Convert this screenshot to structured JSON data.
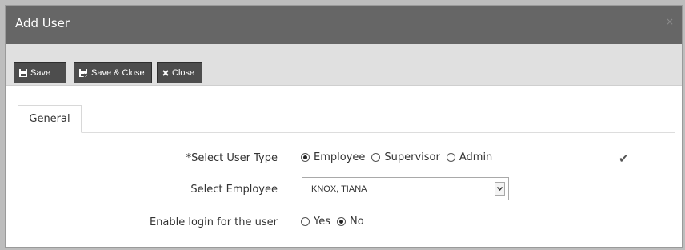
{
  "dialog": {
    "title": "Add User",
    "close_glyph": "×"
  },
  "toolbar": {
    "save_label": "Save",
    "save_close_label": "Save & Close",
    "close_label": "Close"
  },
  "tabs": [
    {
      "label": "General",
      "active": true
    }
  ],
  "form": {
    "user_type": {
      "required_mark": "*",
      "label": "Select User Type",
      "options": [
        "Employee",
        "Supervisor",
        "Admin"
      ],
      "selected": "Employee",
      "valid_glyph": "✔"
    },
    "employee": {
      "label": "Select Employee",
      "value": "KNOX, TIANA"
    },
    "login": {
      "label": "Enable login for the user",
      "options": [
        "Yes",
        "No"
      ],
      "selected": "No"
    }
  },
  "icons": {
    "save": "floppy-disk-icon",
    "save_close": "floppy-disk-close-icon",
    "close": "x-icon",
    "dropdown": "chevron-down-icon",
    "valid": "checkmark-icon"
  },
  "colors": {
    "titlebar": "#666666",
    "toolbar": "#e0e0e0",
    "button": "#4d4d4d"
  }
}
